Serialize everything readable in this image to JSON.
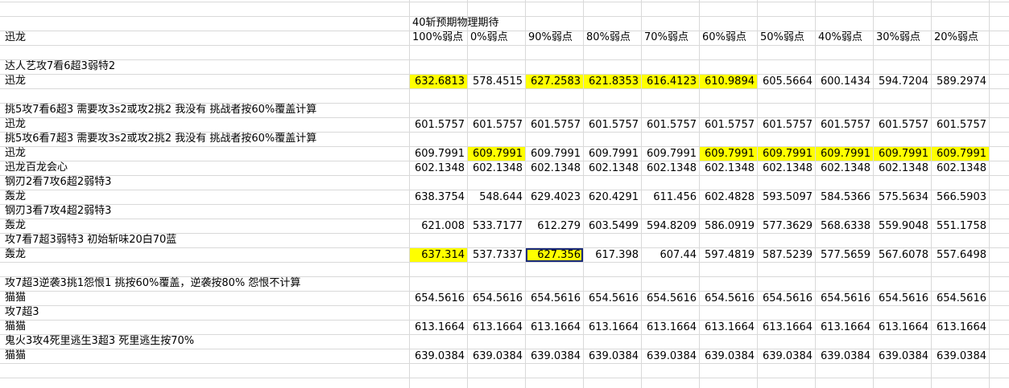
{
  "sheet": {
    "top_title": "40斩预期物理期待",
    "col_headers": [
      "100%弱点",
      "0%弱点",
      "90%弱点",
      "80%弱点",
      "70%弱点",
      "60%弱点",
      "50%弱点",
      "40%弱点",
      "30%弱点",
      "20%弱点"
    ],
    "highlight_color": "#ffff00",
    "rows": [
      {
        "label": "迅龙",
        "vals": []
      },
      {
        "label": "",
        "vals": []
      },
      {
        "label": "达人艺攻7看6超3弱特2",
        "vals": []
      },
      {
        "label": "迅龙",
        "vals": [
          "632.6813",
          "578.4515",
          "627.2583",
          "621.8353",
          "616.4123",
          "610.9894",
          "605.5664",
          "600.1434",
          "594.7204",
          "589.2974"
        ],
        "hl": [
          0,
          2,
          3,
          4,
          5
        ]
      },
      {
        "label": "",
        "vals": []
      },
      {
        "label": "挑5攻7看6超3  需要攻3s2或攻2挑2  我没有  挑战者按60%覆盖计算",
        "vals": []
      },
      {
        "label": "迅龙",
        "vals": [
          "601.5757",
          "601.5757",
          "601.5757",
          "601.5757",
          "601.5757",
          "601.5757",
          "601.5757",
          "601.5757",
          "601.5757",
          "601.5757"
        ]
      },
      {
        "label": "挑5攻6看7超3  需要攻3s2或攻2挑2  我没有  挑战者按60%覆盖计算",
        "vals": []
      },
      {
        "label": "迅龙",
        "vals": [
          "609.7991",
          "609.7991",
          "609.7991",
          "609.7991",
          "609.7991",
          "609.7991",
          "609.7991",
          "609.7991",
          "609.7991",
          "609.7991"
        ],
        "hl": [
          1,
          5,
          6,
          7,
          8,
          9
        ]
      },
      {
        "label": "迅龙百龙会心",
        "vals": [
          "602.1348",
          "602.1348",
          "602.1348",
          "602.1348",
          "602.1348",
          "602.1348",
          "602.1348",
          "602.1348",
          "602.1348",
          "602.1348"
        ]
      },
      {
        "label": "钢刃2看7攻6超2弱特3",
        "vals": []
      },
      {
        "label": "轰龙",
        "vals": [
          "638.3754",
          "548.644",
          "629.4023",
          "620.4291",
          "611.456",
          "602.4828",
          "593.5097",
          "584.5366",
          "575.5634",
          "566.5903"
        ]
      },
      {
        "label": "钢刃3看7攻4超2弱特3",
        "vals": []
      },
      {
        "label": "轰龙",
        "vals": [
          "621.008",
          "533.7177",
          "612.279",
          "603.5499",
          "594.8209",
          "586.0919",
          "577.3629",
          "568.6338",
          "559.9048",
          "551.1758"
        ]
      },
      {
        "label": "攻7看7超3弱特3  初始斩味20白70蓝",
        "vals": []
      },
      {
        "label": "轰龙",
        "vals": [
          "637.314",
          "537.7337",
          "627.356",
          "617.398",
          "607.44",
          "597.4819",
          "587.5239",
          "577.5659",
          "567.6078",
          "557.6498"
        ],
        "hl": [
          0,
          2
        ],
        "sel": 2
      },
      {
        "label": "",
        "vals": []
      },
      {
        "label": "攻7超3逆袭3挑1怨恨1  挑按60%覆盖，逆袭按80%  怨恨不计算",
        "vals": []
      },
      {
        "label": "猫猫",
        "vals": [
          "654.5616",
          "654.5616",
          "654.5616",
          "654.5616",
          "654.5616",
          "654.5616",
          "654.5616",
          "654.5616",
          "654.5616",
          "654.5616"
        ]
      },
      {
        "label": "攻7超3",
        "vals": []
      },
      {
        "label": "猫猫",
        "vals": [
          "613.1664",
          "613.1664",
          "613.1664",
          "613.1664",
          "613.1664",
          "613.1664",
          "613.1664",
          "613.1664",
          "613.1664",
          "613.1664"
        ]
      },
      {
        "label": "鬼火3攻4死里逃生3超3  死里逃生按70%",
        "vals": []
      },
      {
        "label": "猫猫",
        "vals": [
          "639.0384",
          "639.0384",
          "639.0384",
          "639.0384",
          "639.0384",
          "639.0384",
          "639.0384",
          "639.0384",
          "639.0384",
          "639.0384"
        ]
      }
    ]
  }
}
